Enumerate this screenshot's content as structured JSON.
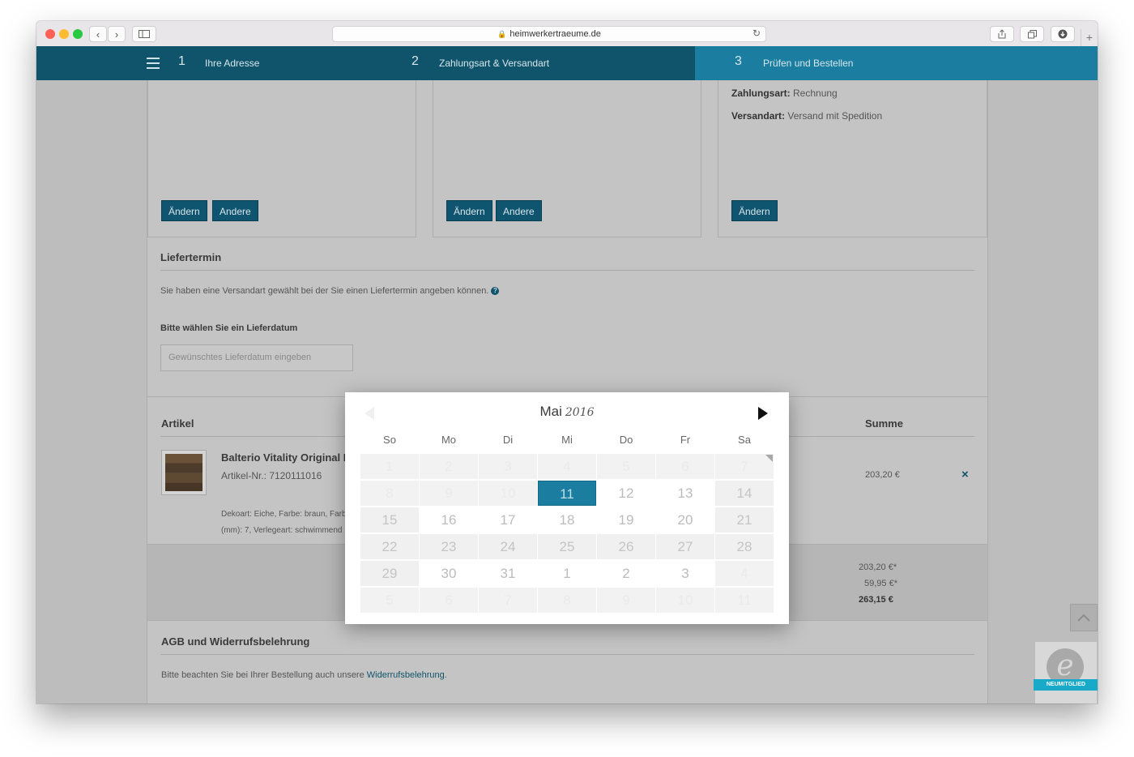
{
  "browser": {
    "url": "heimwerkertraeume.de",
    "back": "‹",
    "forward": "›",
    "new_tab": "+"
  },
  "steps": [
    {
      "number": "1",
      "label": "Ihre Adresse"
    },
    {
      "number": "2",
      "label": "Zahlungsart & Versandart"
    },
    {
      "number": "3",
      "label": "Prüfen und Bestellen"
    }
  ],
  "cards": {
    "button_change": "Ändern",
    "button_other": "Andere",
    "payment_label": "Zahlungsart:",
    "payment_value": "Rechnung",
    "shipping_label": "Versandart:",
    "shipping_value": "Versand mit Spedition"
  },
  "delivery": {
    "title": "Liefertermin",
    "info": "Sie haben eine Versandart gewählt bei der Sie einen Liefertermin angeben können.",
    "help_icon": "?",
    "choose_label": "Bitte wählen Sie ein Lieferdatum",
    "placeholder": "Gewünschtes Lieferdatum eingeben"
  },
  "articles": {
    "col_article": "Artikel",
    "col_sum": "Summe",
    "item": {
      "name": "Balterio Vitality Original E",
      "number": "Artikel-Nr.: 7120111016",
      "desc_line1": "Dekoart: Eiche, Farbe: braun, Farbto",
      "desc_line2": "(mm): 7, Verlegeart: schwimmend",
      "sum": "203,20 €",
      "remove": "×"
    },
    "totals": [
      "203,20 €*",
      "59,95 €*",
      "263,15 €"
    ]
  },
  "agb": {
    "title": "AGB und Widerrufsbelehrung",
    "text": "Bitte beachten Sie bei Ihrer Bestellung auch unsere",
    "link": "Widerrufsbelehrung",
    "period": "."
  },
  "badge": {
    "letter": "e",
    "label": "NEUMITGLIED"
  },
  "calendar": {
    "month": "Mai",
    "year": "2016",
    "weekdays": [
      "So",
      "Mo",
      "Di",
      "Mi",
      "Do",
      "Fr",
      "Sa"
    ],
    "days": [
      "1",
      "2",
      "3",
      "4",
      "5",
      "6",
      "7",
      "8",
      "9",
      "10",
      "11",
      "12",
      "13",
      "14",
      "15",
      "16",
      "17",
      "18",
      "19",
      "20",
      "21",
      "22",
      "23",
      "24",
      "25",
      "26",
      "27",
      "28",
      "29",
      "30",
      "31",
      "1",
      "2",
      "3",
      "4",
      "5",
      "6",
      "7",
      "8",
      "9",
      "10",
      "11"
    ],
    "selected": "11"
  }
}
